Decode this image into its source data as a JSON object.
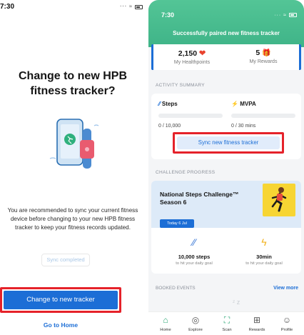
{
  "left": {
    "status_time": "7:30",
    "title": "Change to new HPB fitness tracker?",
    "message": "You are recommended to sync your current fitness device before changing to your new HPB fitness tracker to keep your fitness records updated.",
    "sync_completed_label": "Sync completed",
    "change_button_label": "Change to new tracker",
    "go_home_label": "Go to Home",
    "colors": {
      "primary": "#1c6ed6",
      "highlight": "#e5222a"
    }
  },
  "right": {
    "status_time": "7:30",
    "banner": "Successfully paired new fitness tracker",
    "healthpoints": {
      "value": "2,150",
      "label": "My Healthpoints",
      "icon": "heart-icon"
    },
    "rewards": {
      "value": "5",
      "label": "My Rewards",
      "icon": "gift-icon"
    },
    "activity_label": "ACTIVITY SUMMARY",
    "steps": {
      "label": "Steps",
      "value": "0 / 10,000",
      "icon": "steps-icon"
    },
    "mvpa": {
      "label": "MVPA",
      "value": "0 / 30 mins",
      "icon": "lightning-icon"
    },
    "sync_button_label": "Sync new fitness tracker",
    "challenge_label": "CHALLENGE PROGRESS",
    "challenge": {
      "title": "National Steps Challenge™ Season 6",
      "date": "Today 6 Jul",
      "goal_steps": "10,000 steps",
      "goal_steps_sub": "to hit your daily goal",
      "goal_mvpa": "30min",
      "goal_mvpa_sub": "to hit your daily goal"
    },
    "booked_label": "BOOKED EVENTS",
    "view_more_label": "View more",
    "tabs": [
      {
        "label": "Home",
        "icon": "home-icon"
      },
      {
        "label": "Explore",
        "icon": "compass-icon"
      },
      {
        "label": "Scan",
        "icon": "scan-icon"
      },
      {
        "label": "Rewards",
        "icon": "gift-icon"
      },
      {
        "label": "Profile",
        "icon": "profile-icon"
      }
    ],
    "colors": {
      "header": "#3fb488",
      "accent": "#1c6ed6"
    }
  }
}
